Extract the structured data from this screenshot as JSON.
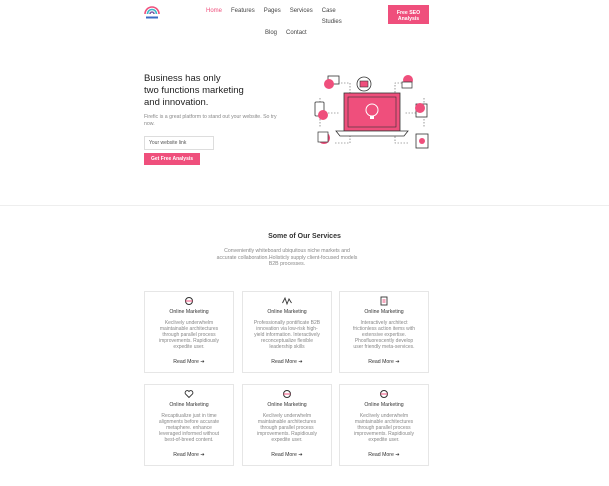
{
  "header": {
    "nav_row1": [
      "Home",
      "Features",
      "Pages",
      "Services",
      "Case Studies"
    ],
    "nav_row2": [
      "Blog",
      "Contact"
    ],
    "cta": "Free SEO Analysis",
    "accent": "#ef4f7c"
  },
  "hero": {
    "title_lines": [
      "Business has only",
      "two functions marketing",
      "and innovation."
    ],
    "text": "Firefic is a great platform to stand out your website. So try now.",
    "input_placeholder": "Your website link",
    "button": "Get Free Analysis"
  },
  "services": {
    "title": "Some of Our Services",
    "subtitle": "Conveniently whiteboard ubiquitous niche markets and accurate collaboration.Holisticly supply client-focused models B2B processes.",
    "cards": [
      {
        "icon": "target-icon",
        "title": "Online Marketing",
        "text": "Keclively underwhelm maintainable architectures through parallel process improvements. Rapidiously expedite user.",
        "more": "Read More"
      },
      {
        "icon": "pulse-icon",
        "title": "Online Marketing",
        "text": "Professionally pontificate B2B innovation via low-risk high-yield information. Interactively reconceptualize flexible leadership skills",
        "more": "Read More"
      },
      {
        "icon": "document-icon",
        "title": "Online Marketing",
        "text": "Interactively architect frictionless action items with extensive expertise. Phosfluorescently develop user friendly meta-services.",
        "more": "Read More"
      },
      {
        "icon": "heart-icon",
        "title": "Online Marketing",
        "text": "Recaptiualize just in time alignments before accurate metaphere. enhance leveraged informed without best-of-breed content.",
        "more": "Read More"
      },
      {
        "icon": "target-icon",
        "title": "Online Marketing",
        "text": "Keclively underwhelm maintainable architectures through parallel process improvements. Rapidiously expedite user.",
        "more": "Read More"
      },
      {
        "icon": "target-icon",
        "title": "Online Marketing",
        "text": "Keclively underwhelm maintainable architectures through parallel process improvements. Rapidiously expedite user.",
        "more": "Read More"
      }
    ]
  }
}
